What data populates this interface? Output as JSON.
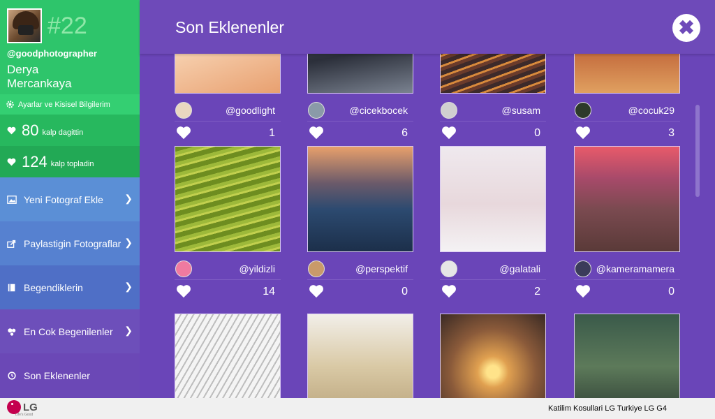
{
  "profile": {
    "rank": "#22",
    "handle": "@goodphotographer",
    "name": "Derya Mercankaya",
    "settings_label": "Ayarlar ve Kisisel Bilgilerim"
  },
  "stats": [
    {
      "value": "80",
      "label": "kalp dagittin"
    },
    {
      "value": "124",
      "label": "kalp topladin"
    }
  ],
  "menu": [
    {
      "label": "Yeni Fotograf Ekle",
      "icon": "image-icon"
    },
    {
      "label": "Paylastigin Fotograflar",
      "icon": "share-icon"
    },
    {
      "label": "Begendiklerin",
      "icon": "book-icon"
    },
    {
      "label": "En Cok Begenilenler",
      "icon": "trophy-icon"
    },
    {
      "label": "Son Eklenenler",
      "icon": "clock-icon"
    }
  ],
  "header": {
    "title": "Son Eklenenler"
  },
  "photos": [
    {
      "user": "@goodlight",
      "likes": "1"
    },
    {
      "user": "@cicekbocek",
      "likes": "6"
    },
    {
      "user": "@susam",
      "likes": "0"
    },
    {
      "user": "@cocuk29",
      "likes": "3"
    },
    {
      "user": "@yildizli",
      "likes": "14"
    },
    {
      "user": "@perspektif",
      "likes": "0"
    },
    {
      "user": "@galatali",
      "likes": "2"
    },
    {
      "user": "@kameramamera",
      "likes": "0"
    },
    {
      "user": "",
      "likes": ""
    },
    {
      "user": "",
      "likes": ""
    },
    {
      "user": "",
      "likes": ""
    },
    {
      "user": "",
      "likes": ""
    }
  ],
  "footer": {
    "brand": "LG",
    "tagline": "Life's Good",
    "terms": "Katilim Kosullari LG Turkiye LG G4"
  },
  "colors": {
    "sidebar_green": "#2ec56b",
    "header_purple": "#6e4ab9",
    "background_purple": "#6a45b8",
    "lg_red": "#c4004e"
  }
}
